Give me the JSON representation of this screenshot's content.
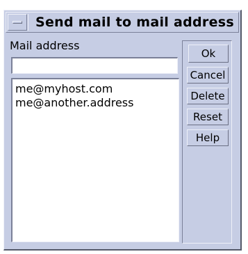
{
  "window": {
    "title": "Send mail to mail address"
  },
  "form": {
    "address_label": "Mail address",
    "address_value": "",
    "addresses": [
      "me@myhost.com",
      "me@another.address"
    ]
  },
  "buttons": {
    "ok": "Ok",
    "cancel": "Cancel",
    "delete": "Delete",
    "reset": "Reset",
    "help": "Help"
  },
  "icons": {
    "window_menu": "window-menu-icon"
  },
  "colors": {
    "background": "#c6cde4",
    "field": "#ffffff"
  }
}
